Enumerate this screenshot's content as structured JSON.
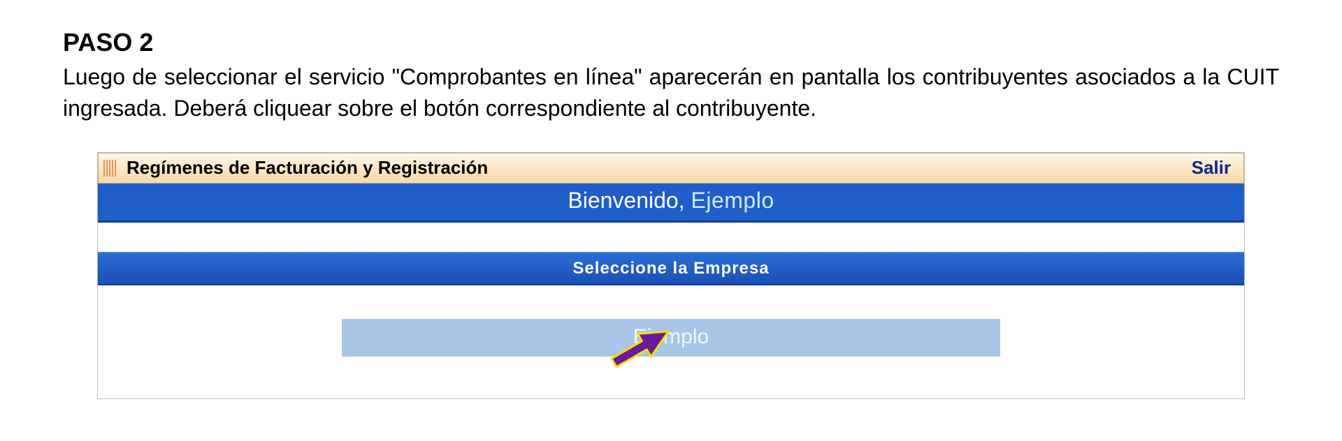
{
  "step": {
    "heading": "PASO 2",
    "body": "Luego de seleccionar el servicio \"Comprobantes en línea\" aparecerán en  pantalla los contribuyentes asociados a la CUIT ingresada. Deberá cliquear sobre el botón correspondiente al contribuyente."
  },
  "titlebar": {
    "title": "Regímenes de Facturación y Registración",
    "exit_label": "Salir"
  },
  "welcome": {
    "greeting": "Bienvenido,",
    "user": "Ejemplo"
  },
  "selector": {
    "prompt": "Seleccione la Empresa",
    "company_label": "Ejemplo"
  }
}
